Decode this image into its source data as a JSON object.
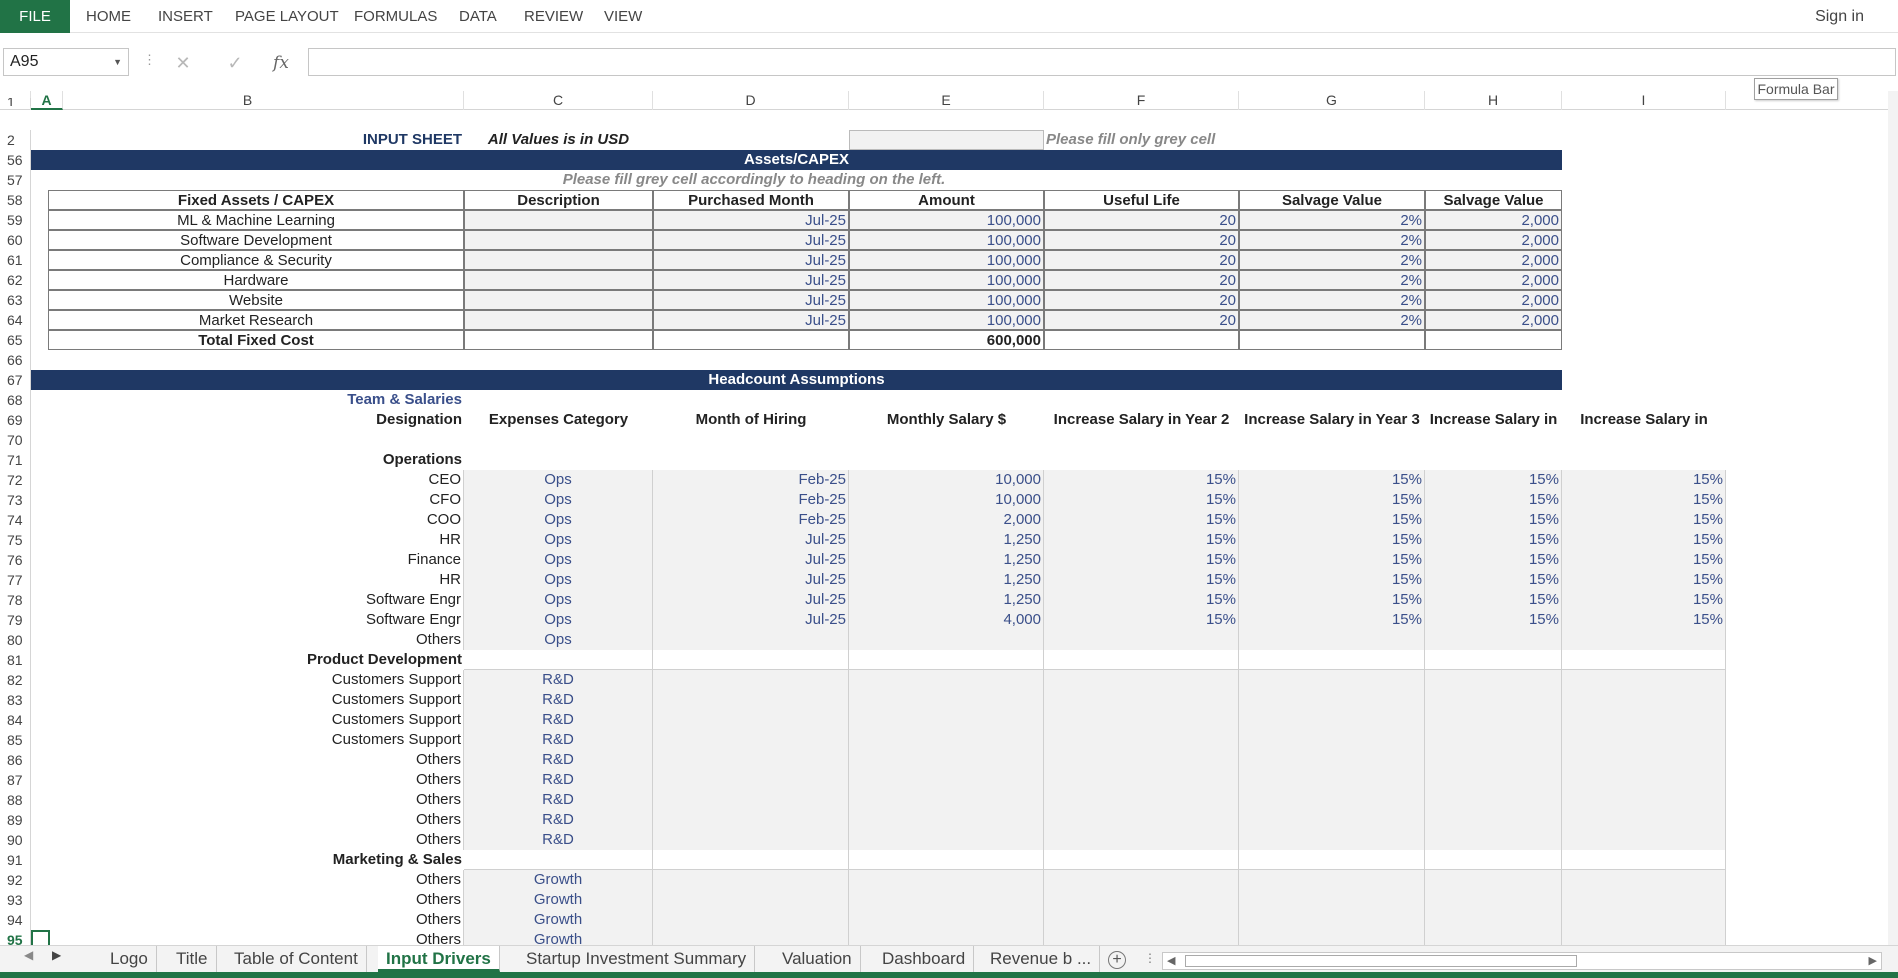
{
  "ribbon": {
    "tabs": [
      "FILE",
      "HOME",
      "INSERT",
      "PAGE LAYOUT",
      "FORMULAS",
      "DATA",
      "REVIEW",
      "VIEW"
    ],
    "sign_in": "Sign in"
  },
  "formula_bar": {
    "name_box": "A95",
    "fx": "fx",
    "content": "",
    "tooltip": "Formula Bar"
  },
  "columns": [
    "A",
    "B",
    "C",
    "D",
    "E",
    "F",
    "G",
    "H",
    "I"
  ],
  "selected_cell": {
    "column": "A",
    "row": "95"
  },
  "top": {
    "title": "INPUT SHEET",
    "units": "All Values is in USD",
    "note": "Please fill only grey cell"
  },
  "capex": {
    "band": "Assets/CAPEX",
    "instruction": "Please fill grey cell accordingly to heading on the left.",
    "headers": [
      "Fixed Assets / CAPEX",
      "Description",
      "Purchased  Month",
      "Amount",
      "Useful Life",
      "Salvage Value",
      "Salvage Value"
    ],
    "rows": [
      {
        "name": "ML & Machine Learning",
        "desc": "",
        "month": "Jul-25",
        "amount": "100,000",
        "life": "20",
        "pct": "2%",
        "value": "2,000"
      },
      {
        "name": "Software Development",
        "desc": "",
        "month": "Jul-25",
        "amount": "100,000",
        "life": "20",
        "pct": "2%",
        "value": "2,000"
      },
      {
        "name": "Compliance & Security",
        "desc": "",
        "month": "Jul-25",
        "amount": "100,000",
        "life": "20",
        "pct": "2%",
        "value": "2,000"
      },
      {
        "name": "Hardware",
        "desc": "",
        "month": "Jul-25",
        "amount": "100,000",
        "life": "20",
        "pct": "2%",
        "value": "2,000"
      },
      {
        "name": "Website",
        "desc": "",
        "month": "Jul-25",
        "amount": "100,000",
        "life": "20",
        "pct": "2%",
        "value": "2,000"
      },
      {
        "name": "Market Research",
        "desc": "",
        "month": "Jul-25",
        "amount": "100,000",
        "life": "20",
        "pct": "2%",
        "value": "2,000"
      }
    ],
    "total_label": "Total Fixed Cost",
    "total_amount": "600,000"
  },
  "headcount": {
    "band": "Headcount Assumptions",
    "team_label": "Team & Salaries",
    "headers": [
      "Designation",
      "Expenses Category",
      "Month of Hiring",
      "Monthly Salary $",
      "Increase Salary in Year 2",
      "Increase Salary in Year 3",
      "Increase Salary in",
      "Increase Salary in"
    ],
    "sections": [
      {
        "title": "Operations",
        "rows": [
          {
            "designation": "CEO",
            "category": "Ops",
            "month": "Feb-25",
            "salary": "10,000",
            "inc": [
              "15%",
              "15%",
              "15%",
              "15%"
            ]
          },
          {
            "designation": "CFO",
            "category": "Ops",
            "month": "Feb-25",
            "salary": "10,000",
            "inc": [
              "15%",
              "15%",
              "15%",
              "15%"
            ]
          },
          {
            "designation": "COO",
            "category": "Ops",
            "month": "Feb-25",
            "salary": "2,000",
            "inc": [
              "15%",
              "15%",
              "15%",
              "15%"
            ]
          },
          {
            "designation": "HR",
            "category": "Ops",
            "month": "Jul-25",
            "salary": "1,250",
            "inc": [
              "15%",
              "15%",
              "15%",
              "15%"
            ]
          },
          {
            "designation": "Finance",
            "category": "Ops",
            "month": "Jul-25",
            "salary": "1,250",
            "inc": [
              "15%",
              "15%",
              "15%",
              "15%"
            ]
          },
          {
            "designation": "HR",
            "category": "Ops",
            "month": "Jul-25",
            "salary": "1,250",
            "inc": [
              "15%",
              "15%",
              "15%",
              "15%"
            ]
          },
          {
            "designation": "Software Engr",
            "category": "Ops",
            "month": "Jul-25",
            "salary": "1,250",
            "inc": [
              "15%",
              "15%",
              "15%",
              "15%"
            ]
          },
          {
            "designation": "Software Engr",
            "category": "Ops",
            "month": "Jul-25",
            "salary": "4,000",
            "inc": [
              "15%",
              "15%",
              "15%",
              "15%"
            ]
          },
          {
            "designation": "Others",
            "category": "Ops",
            "month": "",
            "salary": "",
            "inc": [
              "",
              "",
              "",
              ""
            ]
          }
        ]
      },
      {
        "title": "Product Development",
        "rows": [
          {
            "designation": "Customers Support",
            "category": "R&D",
            "month": "",
            "salary": "",
            "inc": [
              "",
              "",
              "",
              ""
            ]
          },
          {
            "designation": "Customers Support",
            "category": "R&D",
            "month": "",
            "salary": "",
            "inc": [
              "",
              "",
              "",
              ""
            ]
          },
          {
            "designation": "Customers Support",
            "category": "R&D",
            "month": "",
            "salary": "",
            "inc": [
              "",
              "",
              "",
              ""
            ]
          },
          {
            "designation": "Customers Support",
            "category": "R&D",
            "month": "",
            "salary": "",
            "inc": [
              "",
              "",
              "",
              ""
            ]
          },
          {
            "designation": "Others",
            "category": "R&D",
            "month": "",
            "salary": "",
            "inc": [
              "",
              "",
              "",
              ""
            ]
          },
          {
            "designation": "Others",
            "category": "R&D",
            "month": "",
            "salary": "",
            "inc": [
              "",
              "",
              "",
              ""
            ]
          },
          {
            "designation": "Others",
            "category": "R&D",
            "month": "",
            "salary": "",
            "inc": [
              "",
              "",
              "",
              ""
            ]
          },
          {
            "designation": "Others",
            "category": "R&D",
            "month": "",
            "salary": "",
            "inc": [
              "",
              "",
              "",
              ""
            ]
          },
          {
            "designation": "Others",
            "category": "R&D",
            "month": "",
            "salary": "",
            "inc": [
              "",
              "",
              "",
              ""
            ]
          }
        ]
      },
      {
        "title": "Marketing & Sales",
        "rows": [
          {
            "designation": "Others",
            "category": "Growth",
            "month": "",
            "salary": "",
            "inc": [
              "",
              "",
              "",
              ""
            ]
          },
          {
            "designation": "Others",
            "category": "Growth",
            "month": "",
            "salary": "",
            "inc": [
              "",
              "",
              "",
              ""
            ]
          },
          {
            "designation": "Others",
            "category": "Growth",
            "month": "",
            "salary": "",
            "inc": [
              "",
              "",
              "",
              ""
            ]
          },
          {
            "designation": "Others",
            "category": "Growth",
            "month": "",
            "salary": "",
            "inc": [
              "",
              "",
              "",
              ""
            ]
          }
        ]
      }
    ]
  },
  "row_numbers": [
    "1",
    "2",
    "56",
    "57",
    "58",
    "59",
    "60",
    "61",
    "62",
    "63",
    "64",
    "65",
    "66",
    "67",
    "68",
    "69",
    "70",
    "71",
    "72",
    "73",
    "74",
    "75",
    "76",
    "77",
    "78",
    "79",
    "80",
    "81",
    "82",
    "83",
    "84",
    "85",
    "86",
    "87",
    "88",
    "89",
    "90",
    "91",
    "92",
    "93",
    "94",
    "95"
  ],
  "sheet_tabs": [
    "Logo",
    "Title",
    "Table of Content",
    "Input Drivers",
    "Startup Investment Summary",
    "Valuation",
    "Dashboard",
    "Revenue b ..."
  ],
  "active_sheet": "Input Drivers"
}
